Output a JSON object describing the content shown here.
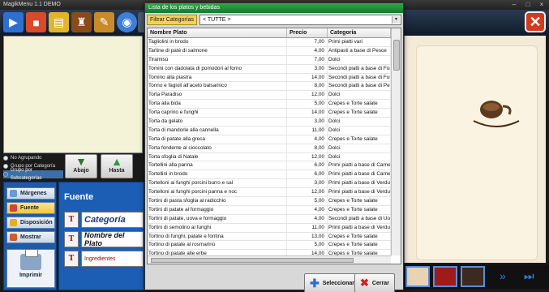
{
  "window": {
    "title": "MagikMenu 1.1 DEMO"
  },
  "grouping": {
    "options": [
      "No Agrupando",
      "Grupo por Categoría",
      "Grupo por Subcategorías"
    ],
    "selected_index": 2
  },
  "nav": {
    "down": "Abajo",
    "to": "Hasta"
  },
  "left_panel": {
    "items": [
      {
        "label": "Márgenes",
        "icon": "margins-icon"
      },
      {
        "label": "Fuente",
        "icon": "font-icon"
      },
      {
        "label": "Disposición",
        "icon": "layout-icon"
      },
      {
        "label": "Mostrar",
        "icon": "show-icon"
      }
    ],
    "active": "Fuente",
    "print": "Imprimir"
  },
  "font_panel": {
    "title": "Fuente",
    "rows": [
      {
        "text": "Categoría"
      },
      {
        "text": "Nombre del Plato"
      },
      {
        "text": "Ingredientes"
      }
    ]
  },
  "dialog": {
    "title": "Lista de los platos y bebidas",
    "filter_label": "Filtrar Categorías",
    "filter_value": "< TUTTE >",
    "columns": [
      "Nombre Plato",
      "Precio",
      "Categoría"
    ],
    "rows": [
      [
        "Tagliolini in brodo",
        "7,00",
        "Primi piatti vari"
      ],
      [
        "Tartine di paté di salmone",
        "4,00",
        "Antipasti a base di Pesce"
      ],
      [
        "Tiramisù",
        "7,00",
        "Dolci"
      ],
      [
        "Tomini con dadolata di pomodori al forno",
        "3,00",
        "Secondi piatti a base di For"
      ],
      [
        "Tomino alla piastra",
        "14,00",
        "Secondi piatti a base di For"
      ],
      [
        "Tonno e fagioli all'aceto balsamico",
        "8,00",
        "Secondi piatti a base di Pe"
      ],
      [
        "Torta Paradiso",
        "12,00",
        "Dolci"
      ],
      [
        "Torta alla bida",
        "5,00",
        "Crepes e Torte salate"
      ],
      [
        "Torta caprino e funghi",
        "14,00",
        "Crepes e Torte salate"
      ],
      [
        "Torta da gelato",
        "3,00",
        "Dolci"
      ],
      [
        "Torta di mandorle alla cannella",
        "11,00",
        "Dolci"
      ],
      [
        "Torta di patate alla greca",
        "4,00",
        "Crepes e Torte salate"
      ],
      [
        "Torta fondente al cioccolato",
        "8,00",
        "Dolci"
      ],
      [
        "Torta sfoglia di Natale",
        "12,00",
        "Dolci"
      ],
      [
        "Tortellini alla panna",
        "6,00",
        "Primi piatti a base di Carne"
      ],
      [
        "Tortellini in brodo",
        "6,00",
        "Primi piatti a base di Carne"
      ],
      [
        "Tortelloni ai funghi porcini burro e sal",
        "3,00",
        "Primi piatti a base di Verdu"
      ],
      [
        "Tortelloni ai funghi porcini panna e noc",
        "12,00",
        "Primi piatti a base di Verdu"
      ],
      [
        "Tortini di pasta sfoglia al radicchio",
        "5,00",
        "Crepes e Torte salate"
      ],
      [
        "Tortini di patate al formaggio",
        "4,00",
        "Crepes e Torte salate"
      ],
      [
        "Tortini di patate, uova e formaggio",
        "4,00",
        "Secondi piatti a base di Uo"
      ],
      [
        "Tortini di semolino ai funghi",
        "11,00",
        "Primi piatti a base di Verdu"
      ],
      [
        "Tortino di funghi, patate e fontina",
        "13,00",
        "Crepes e Torte salate"
      ],
      [
        "Tortino di patate al rosmarino",
        "5,00",
        "Crepes e Torte salate"
      ],
      [
        "Tortino di patate alle erbe",
        "14,00",
        "Crepes e Torte salate"
      ]
    ],
    "select_button": "Seleccionar",
    "close_button": "Cerrar"
  }
}
